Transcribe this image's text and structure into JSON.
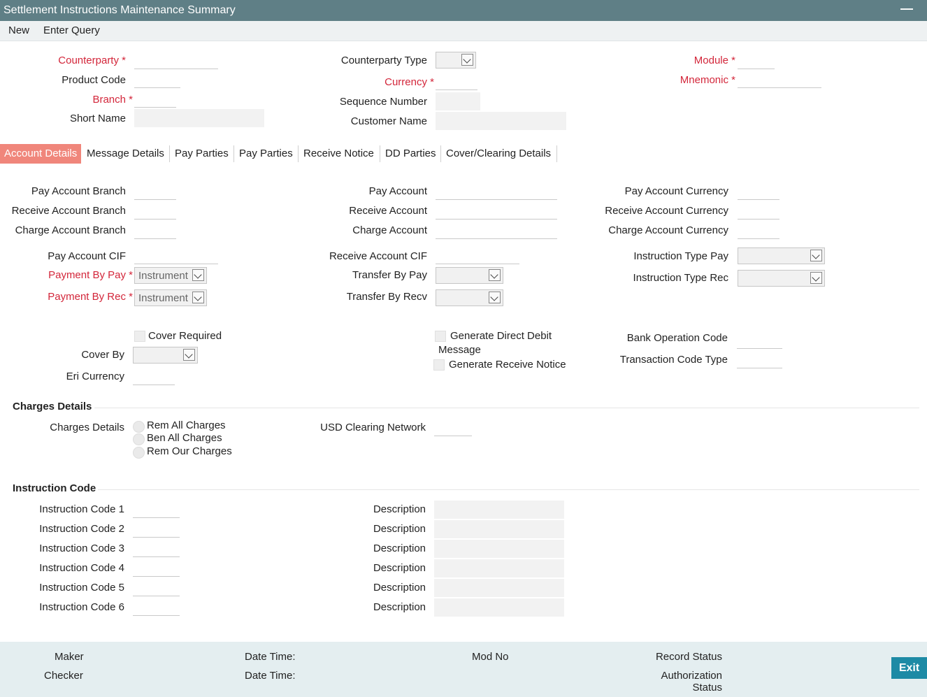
{
  "title": "Settlement Instructions Maintenance Summary",
  "menu": {
    "new": "New",
    "enter_query": "Enter Query"
  },
  "header": {
    "counterparty": "Counterparty",
    "product_code": "Product Code",
    "branch": "Branch",
    "short_name": "Short Name",
    "counterparty_type": "Counterparty Type",
    "currency": "Currency",
    "sequence_number": "Sequence Number",
    "customer_name": "Customer Name",
    "module": "Module",
    "mnemonic": "Mnemonic",
    "required_mark": "*"
  },
  "tabs": [
    "Account Details",
    "Message Details",
    "Pay Parties",
    "Pay Parties",
    "Receive Notice",
    "DD Parties",
    "Cover/Clearing Details"
  ],
  "account": {
    "pay_account_branch": "Pay Account Branch",
    "receive_account_branch": "Receive Account Branch",
    "charge_account_branch": "Charge Account Branch",
    "pay_account": "Pay Account",
    "receive_account": "Receive Account",
    "charge_account": "Charge Account",
    "pay_account_currency": "Pay Account Currency",
    "receive_account_currency": "Receive Account Currency",
    "charge_account_currency": "Charge Account Currency",
    "pay_account_cif": "Pay Account CIF",
    "payment_by_pay": "Payment By Pay",
    "payment_by_rec": "Payment By Rec",
    "payment_by_pay_value": "Instrument",
    "payment_by_rec_value": "Instrument",
    "receive_account_cif": "Receive Account CIF",
    "transfer_by_pay": "Transfer By Pay",
    "transfer_by_recv": "Transfer By Recv",
    "instruction_type_pay": "Instruction Type Pay",
    "instruction_type_rec": "Instruction Type Rec",
    "cover_required": "Cover Required",
    "cover_by": "Cover By",
    "eri_currency": "Eri Currency",
    "generate_direct_debit": "Generate Direct Debit",
    "message": "Message",
    "generate_receive_notice": "Generate Receive Notice",
    "bank_operation_code": "Bank Operation Code",
    "transaction_code_type": "Transaction Code Type"
  },
  "charges": {
    "section": "Charges Details",
    "label": "Charges Details",
    "options": [
      "Rem All Charges",
      "Ben All Charges",
      "Rem Our Charges"
    ],
    "usd_clearing_network": "USD Clearing Network"
  },
  "instruction": {
    "section": "Instruction Code",
    "codes": [
      "Instruction Code 1",
      "Instruction Code 2",
      "Instruction Code 3",
      "Instruction Code 4",
      "Instruction Code 5",
      "Instruction Code 6"
    ],
    "description": "Description"
  },
  "footer": {
    "maker": "Maker",
    "checker": "Checker",
    "date_time": "Date Time:",
    "mod_no": "Mod No",
    "record_status": "Record Status",
    "authorization": "Authorization",
    "status": "Status",
    "exit": "Exit"
  },
  "colors": {
    "titlebar": "#5f7f86",
    "required": "#d3263a",
    "active_tab": "#f0867b",
    "exit": "#1d8aa5",
    "footer": "#e4eef0"
  }
}
